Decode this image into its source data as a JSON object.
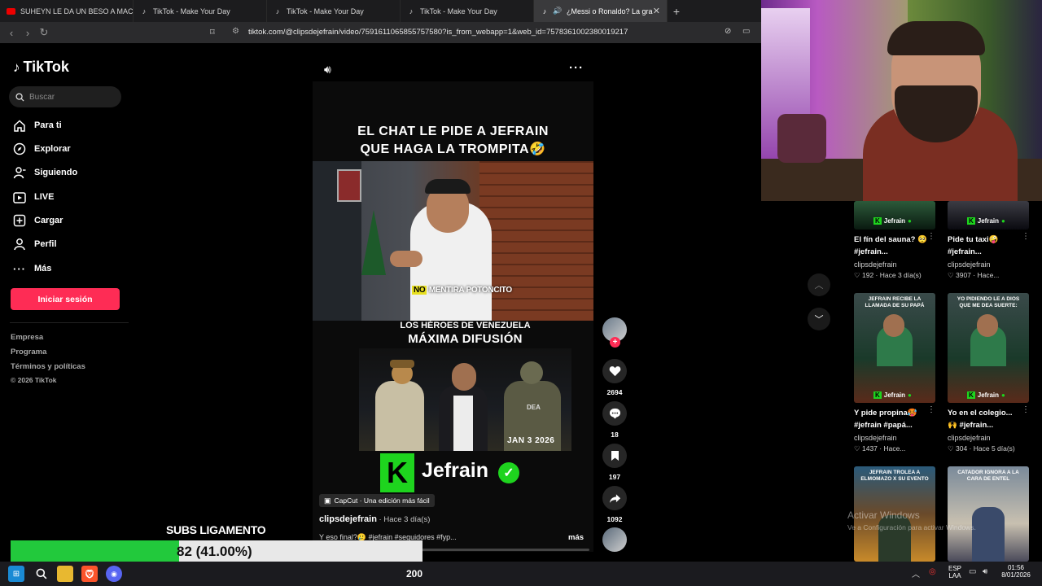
{
  "tabs": [
    {
      "label": "SUHEYN LE DA UN BESO A MACARIU",
      "icon": "youtube-icon",
      "active": false
    },
    {
      "label": "TikTok - Make Your Day",
      "icon": "tiktok-icon",
      "active": false
    },
    {
      "label": "TikTok - Make Your Day",
      "icon": "tiktok-icon",
      "active": false
    },
    {
      "label": "TikTok - Make Your Day",
      "icon": "tiktok-icon",
      "active": false
    },
    {
      "label": "¿Messi o Ronaldo? La gran ba",
      "icon": "tiktok-icon",
      "active": true
    }
  ],
  "address": {
    "url": "tiktok.com/@clipsdejefrain/video/7591611065855757580?is_from_webapp=1&web_id=7578361002380019217"
  },
  "sidebar": {
    "logo": "TikTok",
    "search_placeholder": "Buscar",
    "items": [
      {
        "label": "Para ti",
        "icon": "home-icon"
      },
      {
        "label": "Explorar",
        "icon": "compass-icon"
      },
      {
        "label": "Siguiendo",
        "icon": "following-icon"
      },
      {
        "label": "LIVE",
        "icon": "live-icon"
      },
      {
        "label": "Cargar",
        "icon": "upload-icon"
      },
      {
        "label": "Perfil",
        "icon": "profile-icon"
      },
      {
        "label": "Más",
        "icon": "more-icon"
      }
    ],
    "login_label": "Iniciar sesión",
    "footer": [
      "Empresa",
      "Programa",
      "Términos y políticas",
      "© 2026 TikTok"
    ]
  },
  "video": {
    "caption_line1": "EL CHAT LE PIDE A JEFRAIN",
    "caption_line2": "QUE HAGA LA TROMPITA🤣",
    "subtitle_no": "NO",
    "subtitle_rest": " MENTIRA POTONCITO",
    "banner_line1": "LOS HÉROES DE VENEZUELA",
    "banner_line2": "MÁXIMA DIFUSIÓN",
    "scene_date": "JAN 3 2026",
    "scene_badge": "DEA",
    "brand": "Jefrain",
    "capcut": "CapCut · Una edición más fácil",
    "author": "clipsdejefrain",
    "posted": " · Hace 3 día(s)",
    "desc": "Y eso final?🥲 #jefrain #seguidores #fyp...",
    "more": "más",
    "likes": "2694",
    "comments": "18",
    "saves": "197",
    "shares": "1092"
  },
  "related": [
    {
      "title": "El fín del sauna? 🥺 #jefrain...",
      "user": "clipsdejefrain",
      "likes": "192",
      "age": "Hace 3 día(s)",
      "thumb_text": "",
      "brand": "Jefrain"
    },
    {
      "title": "Pide tu taxi🤪 #jefrain...",
      "user": "clipsdejefrain",
      "likes": "3907",
      "age": "Hace...",
      "thumb_text": "",
      "brand": "Jefrain"
    },
    {
      "title": "Y pide propina🥵 #jefrain #papá...",
      "user": "clipsdejefrain",
      "likes": "1437",
      "age": "Hace...",
      "thumb_text": "JEFRAIN RECIBE LA LLAMADA DE SU PAPÁ",
      "brand": "Jefrain"
    },
    {
      "title": "Yo en el colegio... 🙌 #jefrain...",
      "user": "clipsdejefrain",
      "likes": "304",
      "age": "Hace 5 día(s)",
      "thumb_text": "YO PIDIENDO LE A DIOS QUE ME DEA SUERTE:",
      "brand": "Jefrain"
    },
    {
      "title": "",
      "user": "",
      "likes": "",
      "age": "",
      "thumb_text": "JEFRAIN TROLEA A ELMOMAZO X SU EVENTO",
      "brand": ""
    },
    {
      "title": "",
      "user": "",
      "likes": "",
      "age": "",
      "thumb_text": "CATADOR IGNORA A LA CARA DE ENTEL",
      "brand": ""
    }
  ],
  "watermark": {
    "line1": "Activar Windows",
    "line2": "Ve a Configuración para activar Windows."
  },
  "overlay": {
    "subs_label": "SUBS LIGAMENTO",
    "subs_value": "82 (41.00%)",
    "subs_progress": 0.41,
    "bottom_number": "200"
  },
  "taskbar": {
    "lang1": "ESP",
    "lang2": "LAA",
    "time": "01:56",
    "date": "8/01/2026"
  },
  "colors": {
    "accent": "#fe2c55",
    "brand_green": "#22c93c",
    "jefrain_green": "#1ed41e"
  }
}
